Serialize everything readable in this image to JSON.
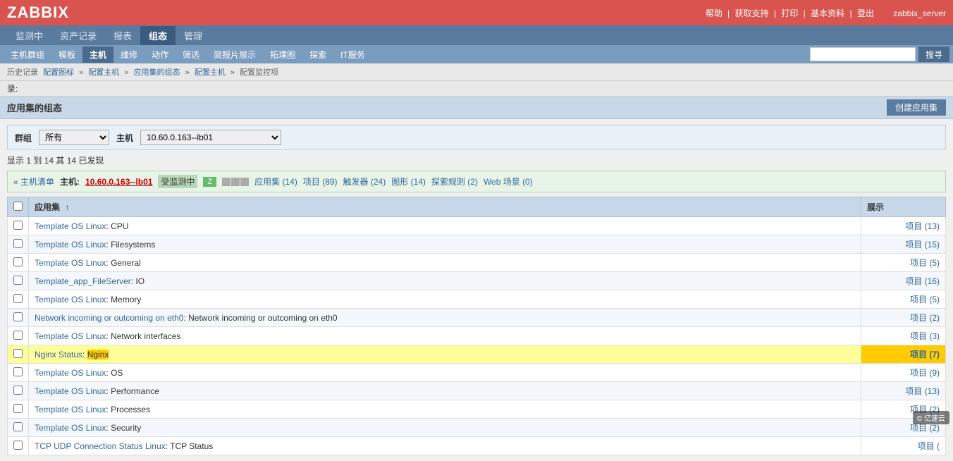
{
  "logo": "ZABBIX",
  "topLinks": {
    "help": "帮助",
    "support": "获取支持",
    "print": "打印",
    "profile": "基本资料",
    "logout": "登出"
  },
  "serverName": "zabbix_server",
  "navItems": [
    {
      "label": "监测中",
      "active": false
    },
    {
      "label": "资产记录",
      "active": false
    },
    {
      "label": "报表",
      "active": false
    },
    {
      "label": "组态",
      "active": true
    },
    {
      "label": "管理",
      "active": false
    }
  ],
  "subNavItems": [
    {
      "label": "主机群组"
    },
    {
      "label": "模板"
    },
    {
      "label": "主机",
      "active": true
    },
    {
      "label": "维修"
    },
    {
      "label": "动作"
    },
    {
      "label": "筛选"
    },
    {
      "label": "简报片展示"
    },
    {
      "label": "拓璞图"
    },
    {
      "label": "探索"
    },
    {
      "label": "IT服务"
    }
  ],
  "search": {
    "placeholder": "",
    "buttonLabel": "搜寻"
  },
  "breadcrumb": [
    {
      "label": "配置图标",
      "link": true
    },
    {
      "label": "配置主机",
      "link": true
    },
    {
      "label": "应用集的组态",
      "link": true
    },
    {
      "label": "配置主机",
      "link": true
    },
    {
      "label": "配置监控项",
      "link": false
    }
  ],
  "historyLabel": "历史记录",
  "recordLabel": "录:",
  "pageTitle": "应用集的组态",
  "createButton": "创建应用集",
  "filterLabels": {
    "group": "群组",
    "host": "主机"
  },
  "filterValues": {
    "group": "所有",
    "host": "10.60.0.163--lb01"
  },
  "countInfo": "显示 1 到 14 其 14 已发现",
  "hostStrip": {
    "listLabel": "« 主机清单",
    "hostLabel": "主机:",
    "hostValue": "10.60.0.163--lb01",
    "monitoring": "受监测中",
    "appLabel": "应用集 (14)",
    "itemLabel": "项目 (89)",
    "triggerLabel": "触发器 (24)",
    "graphLabel": "图形 (14)",
    "discoveryLabel": "探索规则 (2)",
    "webLabel": "Web 场景 (0)"
  },
  "tableHeaders": {
    "checkbox": "",
    "appName": "应用集",
    "display": "展示"
  },
  "tableRows": [
    {
      "id": 1,
      "name": "Template OS Linux",
      "namePart2": "CPU",
      "display": "项目 (13)",
      "highlighted": false
    },
    {
      "id": 2,
      "name": "Template OS Linux",
      "namePart2": "Filesystems",
      "display": "项目 (15)",
      "highlighted": false
    },
    {
      "id": 3,
      "name": "Template OS Linux",
      "namePart2": "General",
      "display": "项目 (5)",
      "highlighted": false
    },
    {
      "id": 4,
      "name": "Template_app_FileServer",
      "namePart2": "IO",
      "display": "项目 (16)",
      "highlighted": false
    },
    {
      "id": 5,
      "name": "Template OS Linux",
      "namePart2": "Memory",
      "display": "项目 (5)",
      "highlighted": false
    },
    {
      "id": 6,
      "name": "Network incoming or outcoming on eth0",
      "namePart2": "Network incoming or outcoming on eth0",
      "fullName": true,
      "display": "项目 (2)",
      "highlighted": false
    },
    {
      "id": 7,
      "name": "Template OS Linux",
      "namePart2": "Network interfaces",
      "display": "项目 (3)",
      "highlighted": false
    },
    {
      "id": 8,
      "name": "Nginx Status",
      "namePart2": "Nginx",
      "display": "项目 (7)",
      "highlighted": true
    },
    {
      "id": 9,
      "name": "Template OS Linux",
      "namePart2": "OS",
      "display": "项目 (9)",
      "highlighted": false
    },
    {
      "id": 10,
      "name": "Template OS Linux",
      "namePart2": "Performance",
      "display": "项目 (13)",
      "highlighted": false
    },
    {
      "id": 11,
      "name": "Template OS Linux",
      "namePart2": "Processes",
      "display": "项目 (2)",
      "highlighted": false
    },
    {
      "id": 12,
      "name": "Template OS Linux",
      "namePart2": "Security",
      "display": "项目 (2)",
      "highlighted": false
    },
    {
      "id": 13,
      "name": "TCP UDP Connection Status Linux",
      "namePart2": "TCP Status",
      "display": "项目 (",
      "highlighted": false
    }
  ],
  "watermark": "© 亿速云"
}
